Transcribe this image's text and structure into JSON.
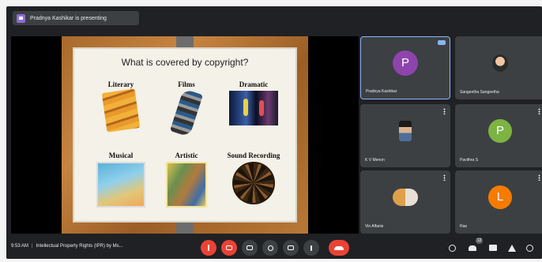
{
  "presenting": {
    "text": "Pradnya Kashikar is presenting"
  },
  "slide": {
    "title": "What is covered by copyright?",
    "categories": [
      {
        "label": "Literary",
        "image": "books-image"
      },
      {
        "label": "Films",
        "image": "filmstrip-image"
      },
      {
        "label": "Dramatic",
        "image": "stage-performance-image"
      },
      {
        "label": "Musical",
        "image": "musical-artwork-image"
      },
      {
        "label": "Artistic",
        "image": "painting-image"
      },
      {
        "label": "Sound Recording",
        "image": "record-disc-image"
      }
    ]
  },
  "participants": [
    {
      "name": "Pradnya Kashikar",
      "initial": "P",
      "color": "#8e44ad"
    },
    {
      "name": "Sangeetha Sangeetha",
      "initial": "",
      "color": ""
    },
    {
      "name": "K V Menon",
      "initial": "",
      "color": ""
    },
    {
      "name": "Pavithra S",
      "initial": "P",
      "color": "#7cb342"
    },
    {
      "name": "Vin Alfanis",
      "initial": "",
      "color": ""
    },
    {
      "name": "Rae",
      "initial": "L",
      "color": "#f57c00"
    }
  ],
  "bottom_bar": {
    "time": "9:53 AM",
    "meeting_title": "Intellectual Property Rights (IPR) by Ms...",
    "participant_count": "12"
  },
  "controls": [
    {
      "name": "microphone-off-button",
      "icon": "microphone-off-icon"
    },
    {
      "name": "camera-off-button",
      "icon": "camera-off-icon"
    },
    {
      "name": "captions-button",
      "icon": "captions-icon"
    },
    {
      "name": "raise-hand-button",
      "icon": "hand-icon"
    },
    {
      "name": "present-button",
      "icon": "present-screen-icon"
    },
    {
      "name": "more-options-button",
      "icon": "more-vertical-icon"
    },
    {
      "name": "leave-call-button",
      "icon": "end-call-icon"
    }
  ]
}
